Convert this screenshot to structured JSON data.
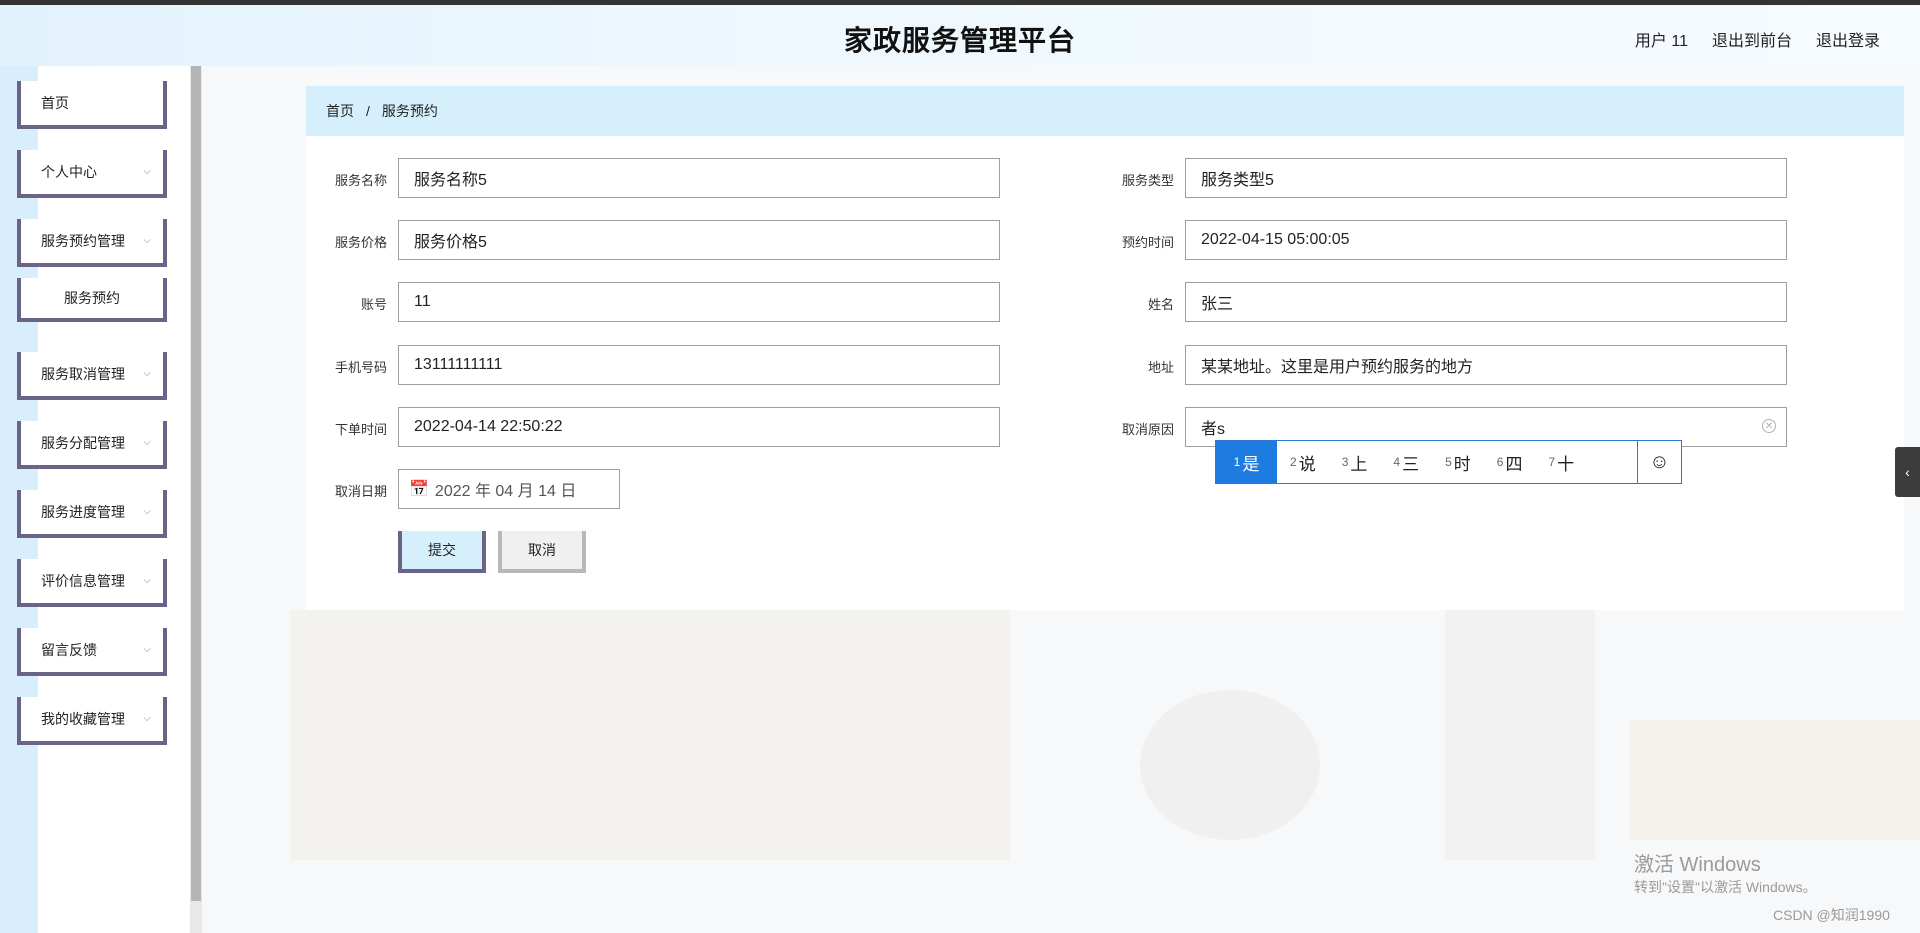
{
  "header": {
    "title": "家政服务管理平台",
    "links": [
      "用户 11",
      "退出到前台",
      "退出登录"
    ]
  },
  "sidebar": {
    "items": [
      {
        "label": "首页",
        "chevron": false
      },
      {
        "label": "个人中心",
        "chevron": true
      },
      {
        "label": "服务预约管理",
        "chevron": true
      },
      {
        "label": "服务预约",
        "chevron": false,
        "sub": true
      },
      {
        "label": "服务取消管理",
        "chevron": true
      },
      {
        "label": "服务分配管理",
        "chevron": true
      },
      {
        "label": "服务进度管理",
        "chevron": true
      },
      {
        "label": "评价信息管理",
        "chevron": true
      },
      {
        "label": "留言反馈",
        "chevron": true
      },
      {
        "label": "我的收藏管理",
        "chevron": true
      }
    ]
  },
  "breadcrumb": {
    "home": "首页",
    "separator": "/",
    "current": "服务预约"
  },
  "form": {
    "left": [
      {
        "label": "服务名称",
        "value": "服务名称5"
      },
      {
        "label": "服务价格",
        "value": "服务价格5"
      },
      {
        "label": "账号",
        "value": "11"
      },
      {
        "label": "手机号码",
        "value": "13111111111"
      },
      {
        "label": "下单时间",
        "value": "2022-04-14 22:50:22"
      }
    ],
    "right": [
      {
        "label": "服务类型",
        "value": "服务类型5"
      },
      {
        "label": "预约时间",
        "value": "2022-04-15 05:00:05"
      },
      {
        "label": "姓名",
        "value": "张三"
      },
      {
        "label": "地址",
        "value": "某某地址。这里是用户预约服务的地方"
      },
      {
        "label": "取消原因",
        "value": "者s"
      }
    ],
    "cancel_date": {
      "label": "取消日期",
      "value": "2022 年 04 月 14 日"
    },
    "submit_label": "提交",
    "cancel_label": "取消"
  },
  "ime": {
    "candidates": [
      {
        "num": "1",
        "text": "是"
      },
      {
        "num": "2",
        "text": "说"
      },
      {
        "num": "3",
        "text": "上"
      },
      {
        "num": "4",
        "text": "三"
      },
      {
        "num": "5",
        "text": "时"
      },
      {
        "num": "6",
        "text": "四"
      },
      {
        "num": "7",
        "text": "十"
      }
    ],
    "emoji": "☺"
  },
  "watermark": {
    "line1": "激活 Windows",
    "line2": "转到\"设置\"以激活 Windows。"
  },
  "csdn": "CSDN @知润1990",
  "icons": {
    "chevron": "chevron-down-icon",
    "calendar": "calendar-icon",
    "clear": "clear-icon",
    "handle": "chevron-left-icon"
  }
}
